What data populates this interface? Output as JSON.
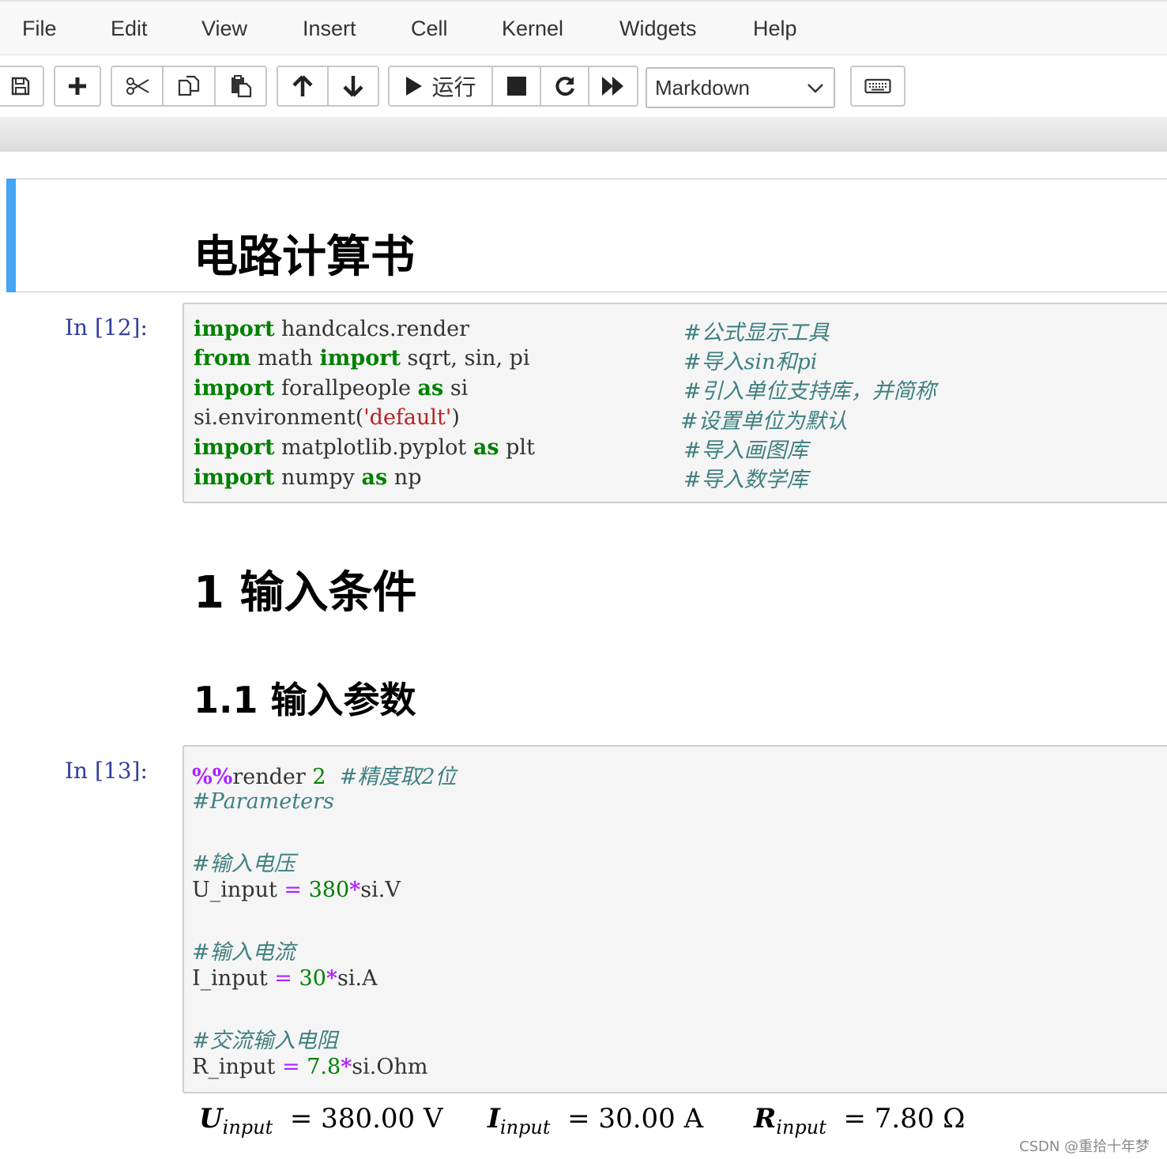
{
  "menu": [
    "File",
    "Edit",
    "View",
    "Insert",
    "Cell",
    "Kernel",
    "Widgets",
    "Help"
  ],
  "toolbar": {
    "run_label": "运行",
    "cell_type": "Markdown"
  },
  "cells": {
    "title": "电路计算书",
    "cell1": {
      "prompt": "In  [12]:",
      "lines": [
        {
          "code": "import handcalcs.render",
          "comment": "#公式显示工具"
        },
        {
          "code": "from math import sqrt, sin, pi",
          "comment": "#导入sin和pi"
        },
        {
          "code": "import forallpeople as si",
          "comment": "#引入单位支持库，并简称"
        },
        {
          "code": "si.environment('default')",
          "comment": "#设置单位为默认"
        },
        {
          "code": "import matplotlib.pyplot as plt",
          "comment": "#导入画图库"
        },
        {
          "code": "import numpy as np",
          "comment": "#导入数学库"
        }
      ]
    },
    "heading1": "1 输入条件",
    "heading2": "1.1 输入参数",
    "cell2": {
      "prompt": "In  [13]:",
      "line1_comment": "#精度取2位",
      "line2": "#Parameters",
      "c_voltage": "#输入电压",
      "c_current": "#输入电流",
      "c_resistance": "#交流输入电阻",
      "u_value": "380",
      "i_value": "30",
      "r_value": "7.8"
    },
    "output": {
      "u_var": "U",
      "u_sub": "input",
      "u_val": "= 380.00 V",
      "i_var": "I",
      "i_sub": "input",
      "i_val": "= 30.00 A",
      "r_var": "R",
      "r_sub": "input",
      "r_val": "= 7.80 Ω"
    }
  },
  "watermark": "CSDN @重拾十年梦"
}
